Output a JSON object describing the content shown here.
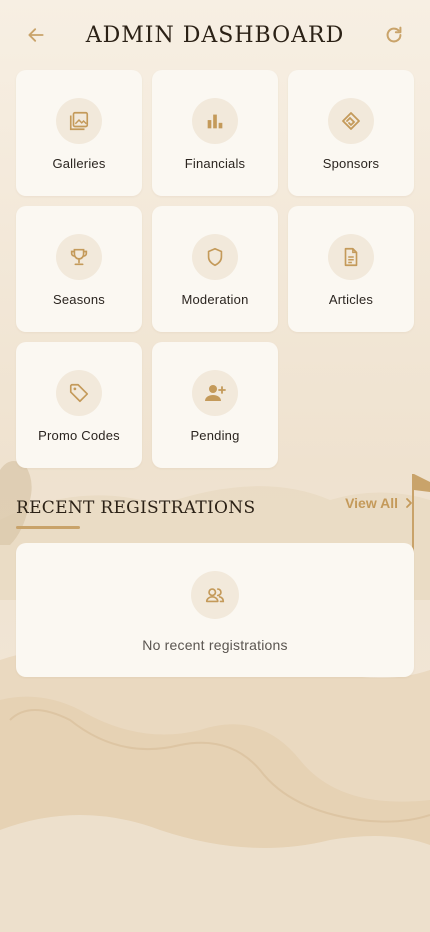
{
  "header": {
    "title": "ADMIN DASHBOARD",
    "back_icon": "arrow-left-icon",
    "refresh_icon": "refresh-icon"
  },
  "tiles": [
    {
      "label": "Galleries",
      "icon": "gallery-icon"
    },
    {
      "label": "Financials",
      "icon": "bar-chart-icon"
    },
    {
      "label": "Sponsors",
      "icon": "handshake-icon"
    },
    {
      "label": "Seasons",
      "icon": "trophy-icon"
    },
    {
      "label": "Moderation",
      "icon": "shield-icon"
    },
    {
      "label": "Articles",
      "icon": "document-icon"
    },
    {
      "label": "Promo Codes",
      "icon": "tag-icon"
    },
    {
      "label": "Pending",
      "icon": "person-add-icon"
    }
  ],
  "recent": {
    "title": "RECENT REGISTRATIONS",
    "view_all": "View All",
    "empty_text": "No recent registrations",
    "empty_icon": "group-icon"
  },
  "colors": {
    "accent": "#c9a36a",
    "tile_bg": "#fbf8f2",
    "icon_circle": "#f2e9db",
    "text_dark": "#2b2116"
  }
}
